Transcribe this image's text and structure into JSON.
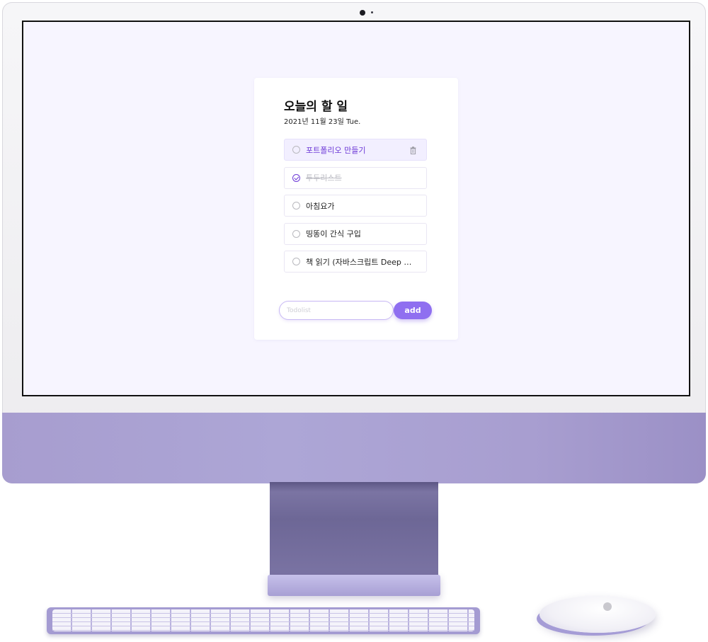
{
  "app": {
    "title": "오늘의 할 일",
    "date": "2021년 11월 23일 Tue."
  },
  "todos": [
    {
      "label": "포트폴리오 만들기",
      "done": false,
      "active": true
    },
    {
      "label": "투두리스트",
      "done": true,
      "active": false
    },
    {
      "label": "아침요가",
      "done": false,
      "active": false
    },
    {
      "label": "띵똥이 간식 구입",
      "done": false,
      "active": false
    },
    {
      "label": "책 읽기 (자바스크립트 Deep …",
      "done": false,
      "active": false
    }
  ],
  "form": {
    "placeholder": "Todolist",
    "value": "",
    "add_label": "add"
  },
  "icons": {
    "item_check": "circle-check-icon",
    "item_delete": "trash-icon"
  },
  "colors": {
    "accent": "#6d3ad7",
    "button": "#8f6ff0",
    "screen_bg": "#f7f5ff",
    "device": "#a79dcf"
  }
}
